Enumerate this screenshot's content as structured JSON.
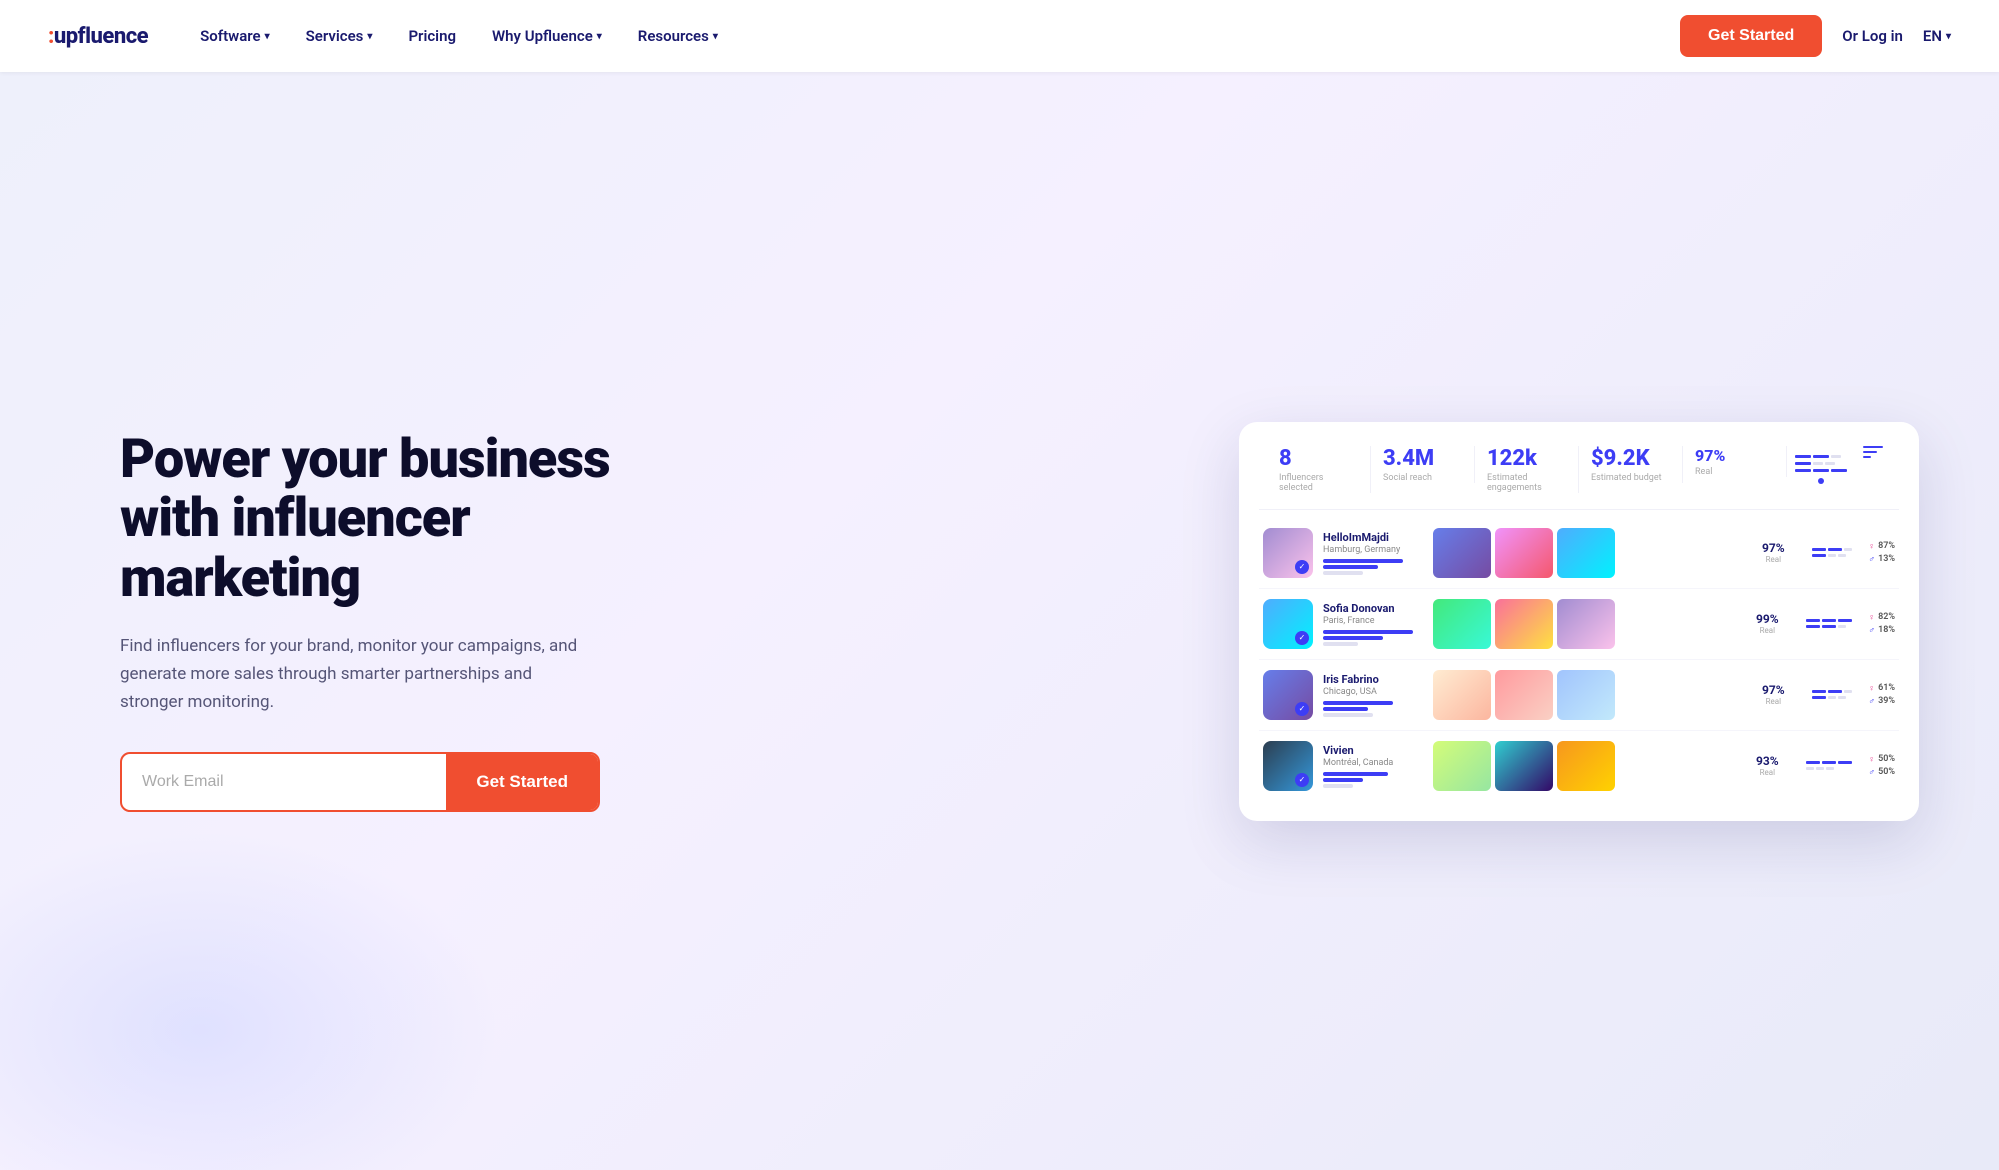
{
  "nav": {
    "logo_text": "upfluence",
    "items": [
      {
        "label": "Software",
        "has_dropdown": true
      },
      {
        "label": "Services",
        "has_dropdown": true
      },
      {
        "label": "Pricing",
        "has_dropdown": false
      },
      {
        "label": "Why Upfluence",
        "has_dropdown": true
      },
      {
        "label": "Resources",
        "has_dropdown": true
      }
    ],
    "cta_label": "Get Started",
    "login_label": "Or Log in",
    "lang_label": "EN"
  },
  "hero": {
    "headline": "Power your business with influencer marketing",
    "subtext": "Find influencers for your brand, monitor your campaigns, and generate more sales through smarter partnerships and stronger monitoring.",
    "email_placeholder": "Work Email",
    "cta_label": "Get Started"
  },
  "dashboard": {
    "stats": [
      {
        "value": "8",
        "label": "Influencers selected"
      },
      {
        "value": "3.4M",
        "label": "Social reach"
      },
      {
        "value": "122k",
        "label": "Estimated engagements"
      },
      {
        "value": "$9.2K",
        "label": "Estimated budget"
      }
    ],
    "score_summary": {
      "value": "97%",
      "label": "Real"
    },
    "influencers": [
      {
        "name": "HelloImMajdi",
        "location": "Hamburg, Germany",
        "score": "97%",
        "score_label": "Real",
        "female_pct": "87%",
        "male_pct": "13%",
        "avatar_color": "purple",
        "photos": [
          "photo-1",
          "photo-2",
          "photo-3"
        ]
      },
      {
        "name": "Sofia Donovan",
        "location": "Paris, France",
        "score": "99%",
        "score_label": "Real",
        "female_pct": "82%",
        "male_pct": "18%",
        "avatar_color": "blue",
        "photos": [
          "photo-4",
          "photo-5",
          "photo-6"
        ]
      },
      {
        "name": "Iris Fabrino",
        "location": "Chicago, USA",
        "score": "97%",
        "score_label": "Real",
        "female_pct": "61%",
        "male_pct": "39%",
        "avatar_color": "default",
        "photos": [
          "photo-7",
          "photo-8",
          "photo-9"
        ]
      },
      {
        "name": "Vivien",
        "location": "Montréal, Canada",
        "score": "93%",
        "score_label": "Real",
        "female_pct": "50%",
        "male_pct": "50%",
        "avatar_color": "dark",
        "photos": [
          "photo-10",
          "photo-11",
          "photo-12"
        ]
      }
    ]
  }
}
